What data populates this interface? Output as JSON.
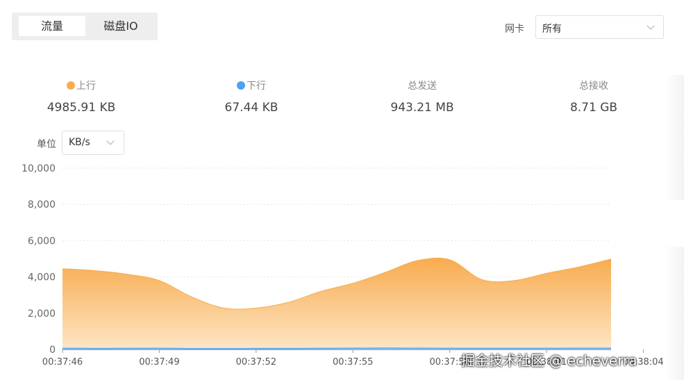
{
  "tabs": [
    {
      "label": "流量",
      "active": true
    },
    {
      "label": "磁盘IO",
      "active": false
    }
  ],
  "nic": {
    "label": "网卡",
    "selected": "所有"
  },
  "stats": [
    {
      "label": "上行",
      "value": "4985.91 KB",
      "dot_color": "#f7ad4f"
    },
    {
      "label": "下行",
      "value": "67.44 KB",
      "dot_color": "#4aa3f4"
    },
    {
      "label": "总发送",
      "value": "943.21 MB"
    },
    {
      "label": "总接收",
      "value": "8.71 GB"
    }
  ],
  "unit": {
    "label": "单位",
    "selected": "KB/s"
  },
  "chart_data": {
    "type": "area",
    "x": [
      "00:37:46",
      "00:37:47",
      "00:37:48",
      "00:37:49",
      "00:37:50",
      "00:37:51",
      "00:37:52",
      "00:37:53",
      "00:37:54",
      "00:37:55",
      "00:37:56",
      "00:37:57",
      "00:37:58",
      "00:37:59",
      "00:38:00",
      "00:38:01",
      "00:38:02",
      "00:38:03"
    ],
    "x_tick_labels": [
      "00:37:46",
      "00:37:49",
      "00:37:52",
      "00:37:55",
      "00:37:58",
      "00:38:01",
      "00:38:04"
    ],
    "series": [
      {
        "name": "上行",
        "color": "#f7ad4f",
        "values": [
          4450,
          4350,
          4150,
          3800,
          2900,
          2280,
          2280,
          2600,
          3200,
          3650,
          4250,
          4900,
          4950,
          3850,
          3800,
          4200,
          4550,
          4985.91
        ]
      },
      {
        "name": "下行",
        "color": "#4aa3f4",
        "values": [
          60,
          55,
          58,
          62,
          50,
          48,
          52,
          55,
          60,
          65,
          70,
          66,
          64,
          62,
          60,
          63,
          66,
          67.44
        ]
      }
    ],
    "ylim": [
      0,
      10000
    ],
    "y_ticks": [
      "0",
      "2,000",
      "4,000",
      "6,000",
      "8,000",
      "10,000"
    ],
    "grid": true
  },
  "watermark": "掘金技术社区 @ echeverra"
}
